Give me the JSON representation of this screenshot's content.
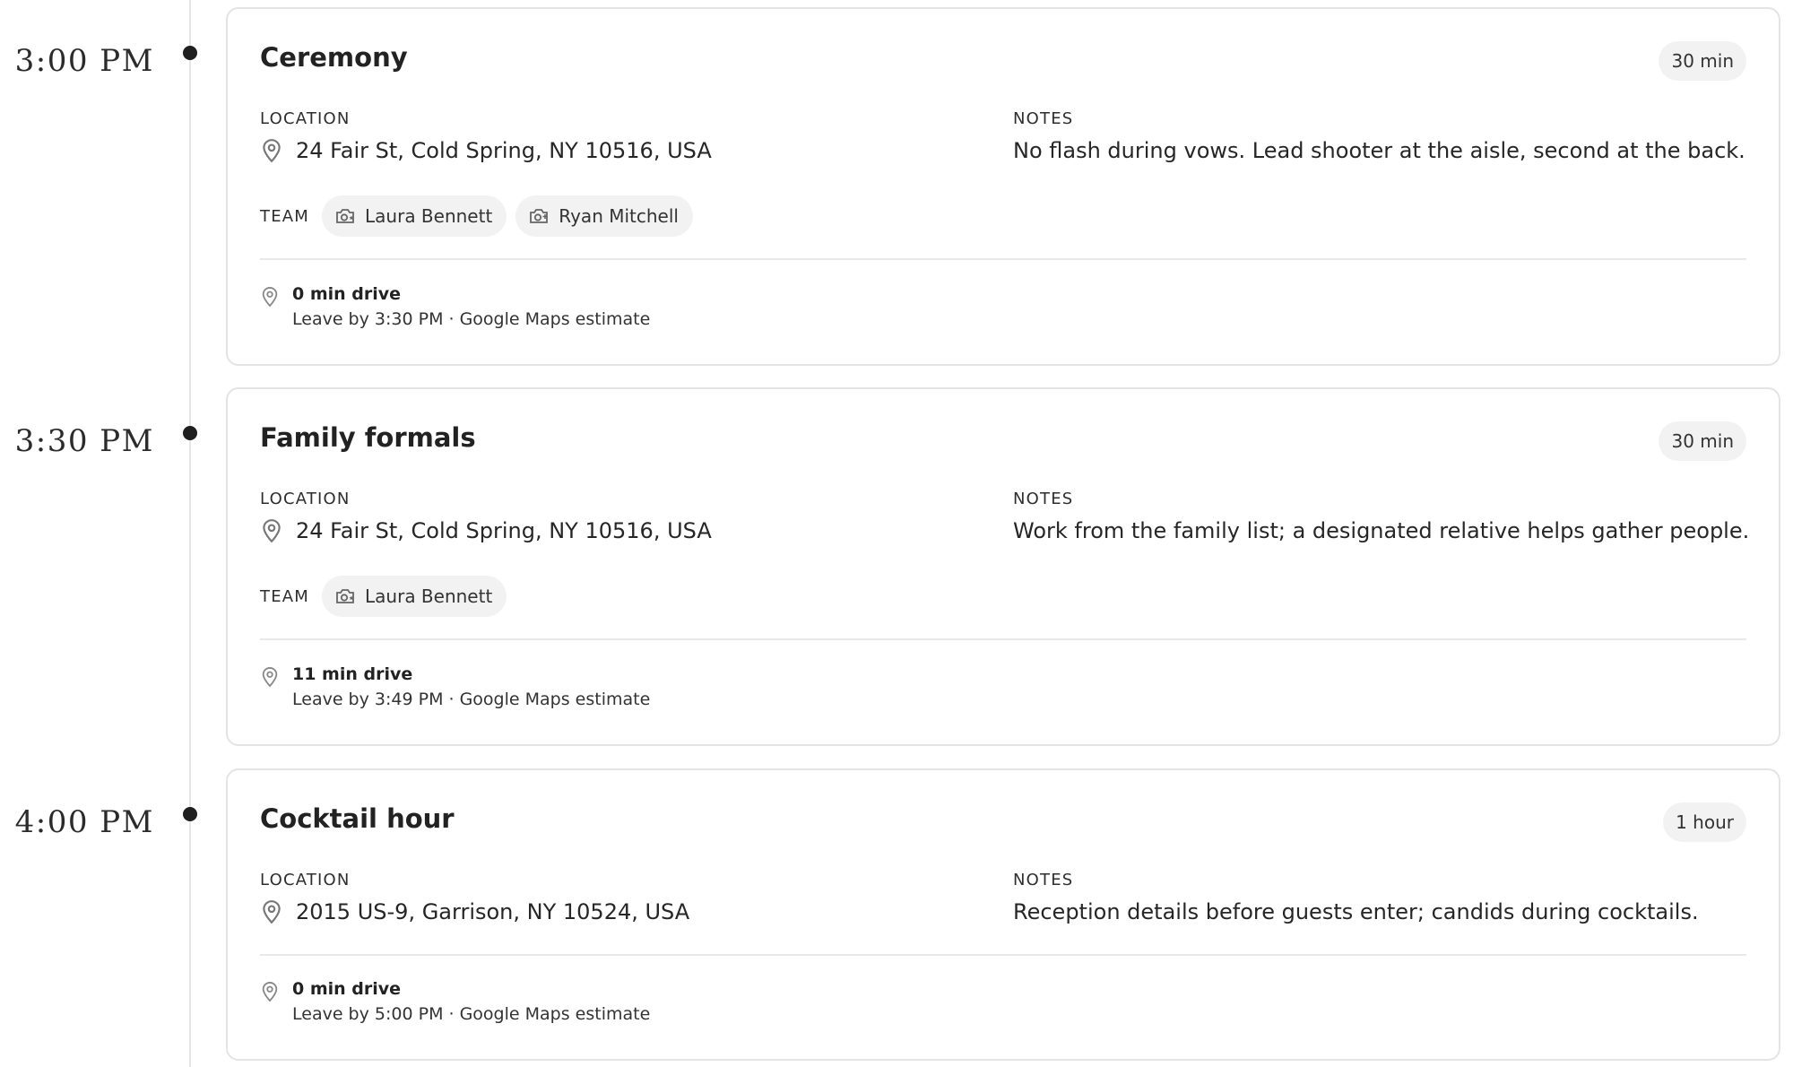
{
  "events": [
    {
      "time": "3:00 PM",
      "title": "Ceremony",
      "duration": "30 min",
      "location_label": "LOCATION",
      "location": "24 Fair St, Cold Spring, NY 10516, USA",
      "notes_label": "NOTES",
      "notes": "No flash during vows. Lead shooter at the aisle, second at the back.",
      "team_label": "TEAM",
      "team": [
        {
          "name": "Laura Bennett",
          "icon": "camera-lead-icon"
        },
        {
          "name": "Ryan Mitchell",
          "icon": "camera-second-icon"
        }
      ],
      "drive_title": "0 min drive",
      "drive_detail": "Leave by 3:30 PM · Google Maps estimate"
    },
    {
      "time": "3:30 PM",
      "title": "Family formals",
      "duration": "30 min",
      "location_label": "LOCATION",
      "location": "24 Fair St, Cold Spring, NY 10516, USA",
      "notes_label": "NOTES",
      "notes": "Work from the family list; a designated relative helps gather people.",
      "team_label": "TEAM",
      "team": [
        {
          "name": "Laura Bennett",
          "icon": "camera-lead-icon"
        }
      ],
      "drive_title": "11 min drive",
      "drive_detail": "Leave by 3:49 PM · Google Maps estimate"
    },
    {
      "time": "4:00 PM",
      "title": "Cocktail hour",
      "duration": "1 hour",
      "location_label": "LOCATION",
      "location": "2015 US-9, Garrison, NY 10524, USA",
      "notes_label": "NOTES",
      "notes": "Reception details before guests enter; candids during cocktails.",
      "drive_title": "0 min drive",
      "drive_detail": "Leave by 5:00 PM · Google Maps estimate"
    }
  ]
}
